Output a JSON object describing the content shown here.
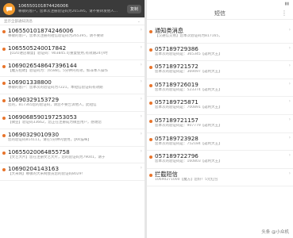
{
  "left": {
    "banner": {
      "title": "106550101874426006",
      "body": "尊敬的客户，您本次注册验证码为265395，请不要转发他人...",
      "button": "复制"
    },
    "filter_label": "显示全部通知消息",
    "messages": [
      {
        "sender": "106550101874246006",
        "preview": "尊敬的客户，您本次注册的短信验证码为265395，请不要转"
      },
      {
        "sender": "1065505240017842",
        "preview": "【O2O进店联盟】验证码：903845.可重复使用,有效期24小时"
      },
      {
        "sender": "1069026548647396144",
        "preview": "【魔方招聘】验证码为：[6588]，5分钟内有效，如非本人操作"
      },
      {
        "sender": "106901338800",
        "preview": "尊敬的客户：您本次的验证码为7221，本短信验证码有效期"
      },
      {
        "sender": "10690329153729",
        "preview": "您的，817365您的验证码，请您不要告诉他人，此短信"
      },
      {
        "sender": "1069068590197253053",
        "preview": "【微豆】验证码33662，您正在注册成为微豆用户，感谢您"
      },
      {
        "sender": "10690329010930",
        "preview": "您的验证码814111，请在5分钟内使用，【KK猫咪】"
      },
      {
        "sender": "10655020064855758",
        "preview": "【文艺大片】您在注册文艺大片，您的验证码为79041，请于"
      },
      {
        "sender": "10690204143163",
        "preview": "【大米网】尊敬的大米网会员您的验证码8029!"
      }
    ]
  },
  "right": {
    "header_title": "短信",
    "more": "⋮",
    "messages": [
      {
        "sender": "通知类消息",
        "preview": "【汉通信交易】您本次验证码为817165，",
        "unread": true
      },
      {
        "sender": "057189729386",
        "preview": "您本次的验证码是：365345【返利大王】",
        "unread": true
      },
      {
        "sender": "057189721572",
        "preview": "您本次的验证码是：369497【返利大王】",
        "unread": true
      },
      {
        "sender": "057189726019",
        "preview": "您本次的验证码是：523374【返利大王】",
        "unread": true
      },
      {
        "sender": "057189725871",
        "preview": "您本次的验证码是：700891【返利大王】",
        "unread": true
      },
      {
        "sender": "057189721157",
        "preview": "您本次的验证码是：907779【返利大王】",
        "unread": true
      },
      {
        "sender": "057189723928",
        "preview": "您本次的验证码是：752184【返利大王】",
        "unread": true
      },
      {
        "sender": "057189722796",
        "preview": "您本次的验证码是：160803【返利大王】",
        "unread": true
      },
      {
        "sender": "拦截短信",
        "preview": "10690271000【魔方】您好！5元红包",
        "unread": true
      }
    ]
  },
  "watermark": "头条 @小众机"
}
